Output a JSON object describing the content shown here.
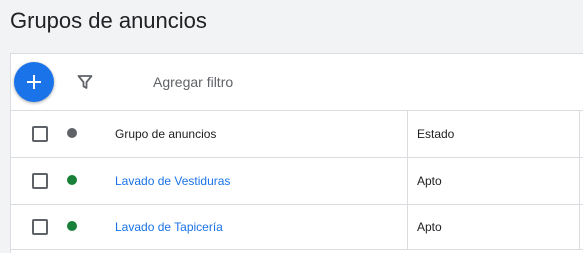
{
  "page": {
    "title": "Grupos de anuncios"
  },
  "toolbar": {
    "add_icon": "plus-icon",
    "filter_icon": "funnel-icon",
    "filter_label": "Agregar filtro"
  },
  "table": {
    "columns": [
      "Grupo de anuncios",
      "Estado"
    ],
    "rows": [
      {
        "name": "Lavado de Vestiduras",
        "status": "Apto",
        "status_color": "#188038"
      },
      {
        "name": "Lavado de Tapicería",
        "status": "Apto",
        "status_color": "#188038"
      }
    ],
    "header_status_color": "#5f6368"
  },
  "colors": {
    "accent": "#1a73e8",
    "status_ok": "#188038"
  }
}
